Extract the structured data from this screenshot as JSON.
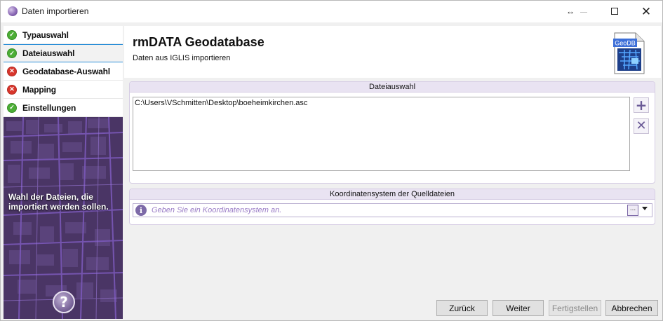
{
  "window": {
    "title": "Daten importieren"
  },
  "sidebar": {
    "steps": [
      {
        "label": "Typauswahl",
        "status": "ok"
      },
      {
        "label": "Dateiauswahl",
        "status": "ok",
        "active": true
      },
      {
        "label": "Geodatabase-Auswahl",
        "status": "error"
      },
      {
        "label": "Mapping",
        "status": "error"
      },
      {
        "label": "Einstellungen",
        "status": "ok"
      }
    ],
    "hint": "Wahl der Dateien, die importiert werden sollen.",
    "help_symbol": "?"
  },
  "header": {
    "title": "rmDATA Geodatabase",
    "subtitle": "Daten aus IGLIS importieren",
    "logo_text": "GeoDB"
  },
  "file_section": {
    "title": "Dateiauswahl",
    "files": [
      "C:\\Users\\VSchmitten\\Desktop\\boeheimkirchen.asc"
    ]
  },
  "coord_section": {
    "title": "Koordinatensystem der Quelldateien",
    "placeholder": "Geben Sie ein Koordinatensystem an.",
    "browse_label": "..."
  },
  "buttons": {
    "back": "Zurück",
    "next": "Weiter",
    "finish": "Fertigstellen",
    "cancel": "Abbrechen"
  },
  "colors": {
    "accent": "#7d6aa8",
    "ok": "#4cae36",
    "error": "#d8362c",
    "sidebar_bg": "#4a3565",
    "active_border": "#2d8fd8"
  }
}
